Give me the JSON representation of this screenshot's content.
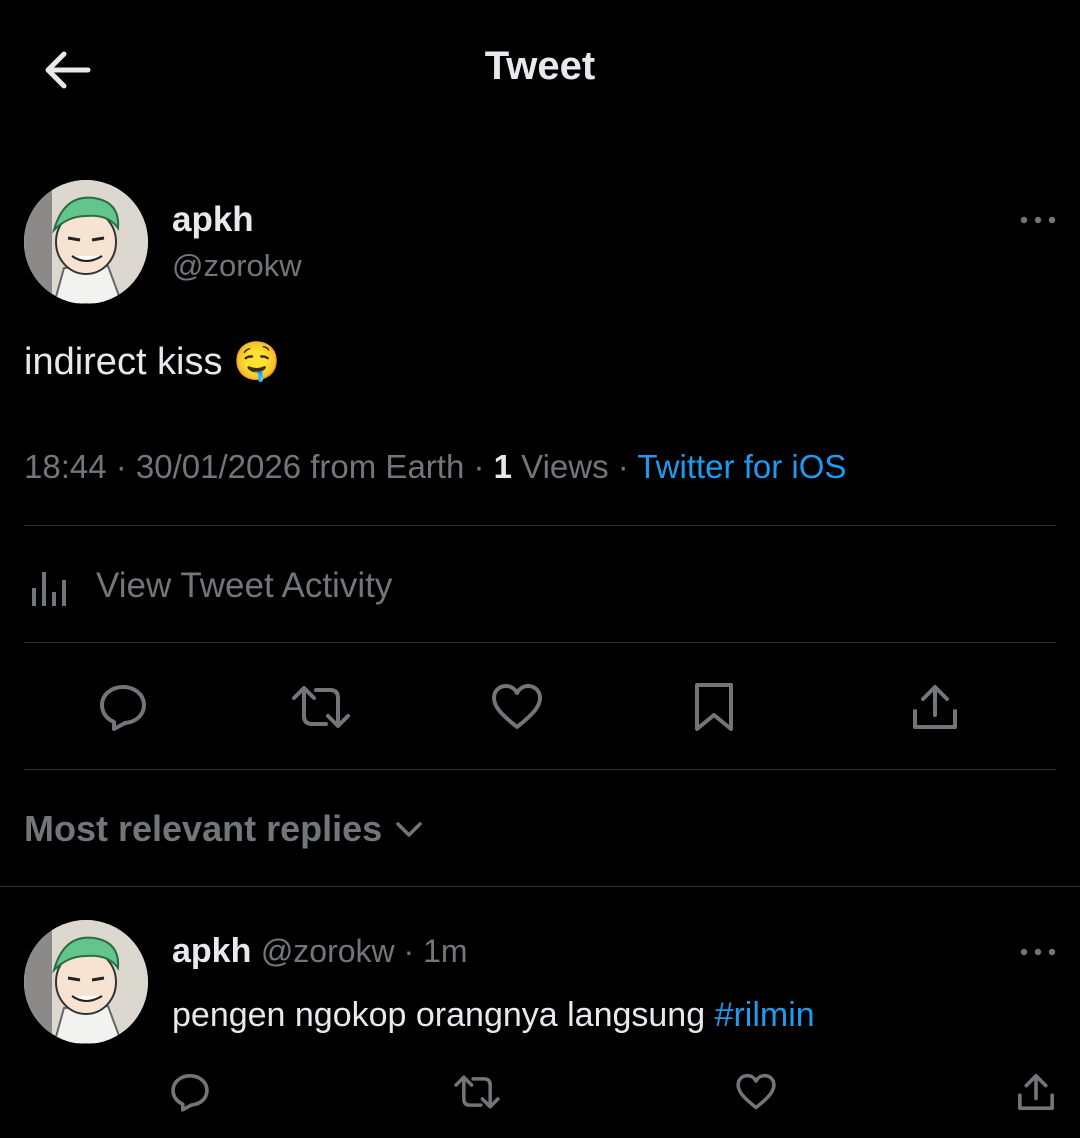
{
  "header": {
    "title": "Tweet",
    "back_icon": "arrow-left-icon"
  },
  "tweet": {
    "author_name": "apkh",
    "author_handle": "@zorokw",
    "text": "indirect kiss",
    "emoji": "🤤",
    "time": "18:44",
    "sep1": " · ",
    "date": "30/01/2026",
    "location": " from Earth",
    "sep2": " · ",
    "views_count": "1",
    "views_label": " Views",
    "sep3": " · ",
    "source": "Twitter for iOS",
    "more_icon": "more-icon"
  },
  "activity": {
    "label": "View Tweet Activity",
    "icon": "analytics-icon"
  },
  "actions": [
    "reply-icon",
    "retweet-icon",
    "like-icon",
    "bookmark-icon",
    "share-icon"
  ],
  "replies_section": {
    "label": "Most relevant replies",
    "icon": "chevron-down-icon"
  },
  "reply": {
    "author_name": "apkh",
    "author_handle": "@zorokw",
    "sep": " · ",
    "time": "1m",
    "text": "pengen ngokop orangnya langsung ",
    "hashtag": "#rilmin"
  },
  "colors": {
    "background": "#000000",
    "text": "#e7e9ea",
    "muted": "#71767b",
    "accent": "#1d9bf0",
    "divider": "#2f3336"
  }
}
